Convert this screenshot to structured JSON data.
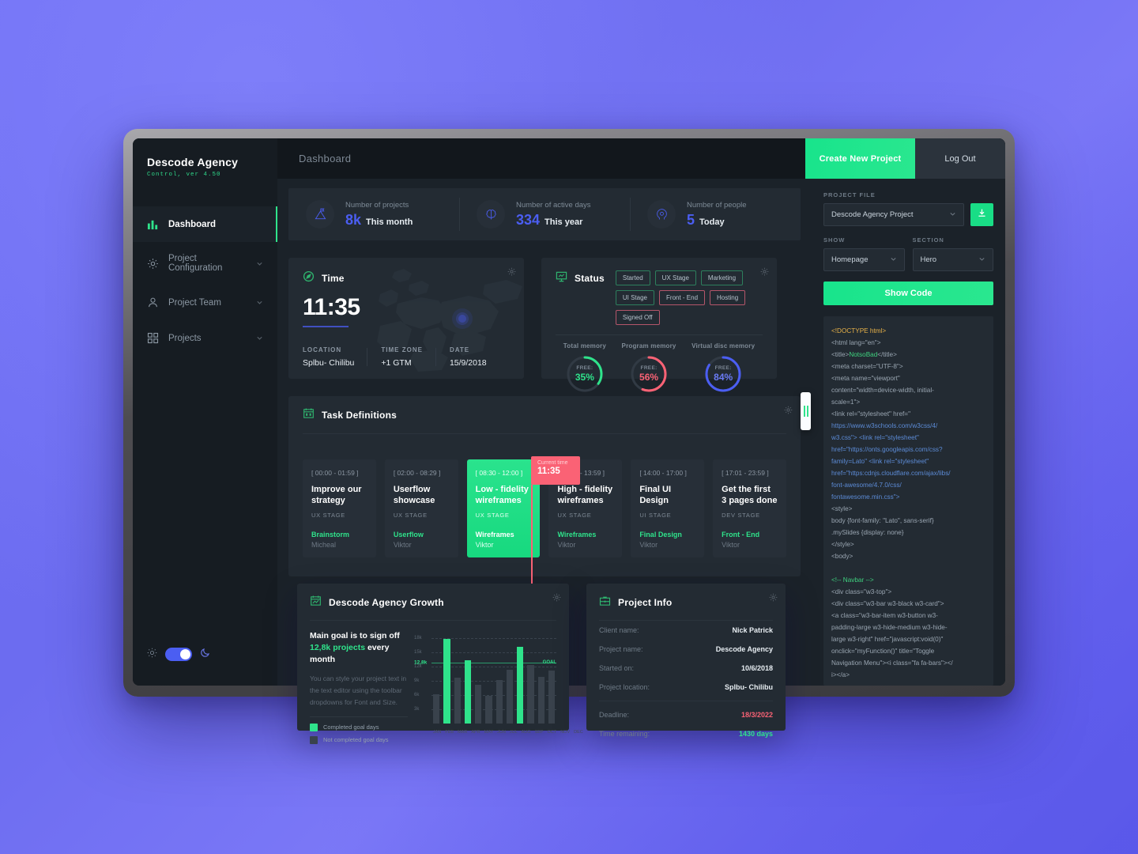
{
  "brand": {
    "title": "Descode Agency",
    "subtitle": "Control, ver 4.50"
  },
  "sidebar": {
    "items": [
      {
        "label": "Dashboard",
        "icon": "chart-bar-icon",
        "active": true,
        "chevron": false
      },
      {
        "label": "Project Configuration",
        "icon": "gear-icon",
        "active": false,
        "chevron": true
      },
      {
        "label": "Project Team",
        "icon": "user-icon",
        "active": false,
        "chevron": true
      },
      {
        "label": "Projects",
        "icon": "grid-icon",
        "active": false,
        "chevron": true
      }
    ],
    "theme_toggle": {
      "light_icon": "sun-icon",
      "dark_icon": "moon-icon",
      "state": "on",
      "accent": "#4b5ef2"
    }
  },
  "topbar": {
    "title": "Dashboard",
    "create_label": "Create New Project",
    "logout_label": "Log Out"
  },
  "stats": [
    {
      "icon": "mountain-flag-icon",
      "label": "Number of projects",
      "value": "8k",
      "period": "This month"
    },
    {
      "icon": "brain-icon",
      "label": "Number of active days",
      "value": "334",
      "period": "This year"
    },
    {
      "icon": "head-gear-icon",
      "label": "Number of people",
      "value": "5",
      "period": "Today"
    }
  ],
  "time_card": {
    "title": "Time",
    "icon": "compass-icon",
    "clock": "11:35",
    "meta": [
      {
        "label": "LOCATION",
        "value": "Splbu- Chilibu"
      },
      {
        "label": "TIME ZONE",
        "value": "+1 GTM"
      },
      {
        "label": "DATE",
        "value": "15/9/2018"
      }
    ]
  },
  "status_card": {
    "title": "Status",
    "icon": "presentation-icon",
    "badges": [
      {
        "label": "Started",
        "tone": "green"
      },
      {
        "label": "UX Stage",
        "tone": "green"
      },
      {
        "label": "Marketing",
        "tone": "green"
      },
      {
        "label": "UI Stage",
        "tone": "green"
      },
      {
        "label": "Front - End",
        "tone": "red"
      },
      {
        "label": "Hosting",
        "tone": "red"
      },
      {
        "label": "Signed Off",
        "tone": "red"
      }
    ],
    "rings": [
      {
        "label": "Total memory",
        "free_label": "FREE:",
        "pct": "35%",
        "value": 35,
        "color": "#2fe38b"
      },
      {
        "label": "Program memory",
        "free_label": "FREE:",
        "pct": "56%",
        "value": 56,
        "color": "#fa6275"
      },
      {
        "label": "Virtual disc memory",
        "free_label": "FREE:",
        "pct": "84%",
        "value": 84,
        "color": "#4b5ef2"
      }
    ]
  },
  "tasks_card": {
    "title": "Task Definitions",
    "icon": "calendar-task-icon",
    "current_time_label": "Current time",
    "current_time": "11:35",
    "tasks": [
      {
        "time": "[ 00:00 - 01:59 ]",
        "name": "Improve our strategy",
        "stage": "UX STAGE",
        "tag": "Brainstorm",
        "user": "Micheal",
        "highlighted": false
      },
      {
        "time": "[ 02:00 - 08:29 ]",
        "name": "Userflow showcase",
        "stage": "UX STAGE",
        "tag": "Userflow",
        "user": "Viktor",
        "highlighted": false
      },
      {
        "time": "[ 08:30 - 12:00 ]",
        "name": "Low - fidelity wireframes",
        "stage": "UX STAGE",
        "tag": "Wireframes",
        "user": "Viktor",
        "highlighted": true
      },
      {
        "time": "[ 12:01 - 13:59 ]",
        "name": "High - fidelity wireframes",
        "stage": "UX STAGE",
        "tag": "Wireframes",
        "user": "Viktor",
        "highlighted": false
      },
      {
        "time": "[ 14:00 - 17:00 ]",
        "name": "Final UI Design",
        "stage": "UI STAGE",
        "tag": "Final Design",
        "user": "Viktor",
        "highlighted": false
      },
      {
        "time": "[ 17:01 - 23:59 ]",
        "name": "Get the first 3 pages done",
        "stage": "DEV STAGE",
        "tag": "Front - End",
        "user": "Viktor",
        "highlighted": false
      }
    ]
  },
  "growth_card": {
    "title": "Descode Agency Growth",
    "icon": "calendar-chart-icon",
    "goal_head_a": "Main goal is to sign off",
    "goal_head_b": "12,8k projects",
    "goal_head_c": " every month",
    "paragraph": "You can style your project text in the text editor using the toolbar dropdowns for Font and Size.",
    "legend": [
      {
        "label": "Completed goal days",
        "color": "#2fe38b"
      },
      {
        "label": "Not completed goal days",
        "color": "#39424c"
      }
    ]
  },
  "chart_data": {
    "type": "bar",
    "title": "Descode Agency Growth",
    "categories": [
      "JAN",
      "FEB",
      "MAR",
      "APR",
      "MAY",
      "JUN",
      "JUL",
      "AUG",
      "SEP",
      "OCT",
      "NOV",
      "DEC"
    ],
    "values": [
      6.2,
      17.8,
      9.6,
      13.4,
      8.2,
      5.9,
      9.2,
      11.4,
      16.2,
      12.4,
      9.8,
      11.2
    ],
    "completed": [
      false,
      true,
      false,
      true,
      false,
      false,
      false,
      false,
      true,
      false,
      false,
      false
    ],
    "goal": 12.8,
    "goal_label": "12,8k",
    "goal_tag": "GOAL",
    "yticks": [
      "18k",
      "15k",
      "12k",
      "9k",
      "6k",
      "3k"
    ],
    "ytick_values": [
      18,
      15,
      12,
      9,
      6,
      3
    ],
    "ylim": [
      0,
      19
    ],
    "xlabel": "",
    "ylabel": "",
    "grid": true,
    "legend_position": "left",
    "series": [
      {
        "name": "Completed goal days",
        "color": "#2fe38b"
      },
      {
        "name": "Not completed goal days",
        "color": "#39424c"
      }
    ]
  },
  "info_card": {
    "title": "Project Info",
    "icon": "briefcase-icon",
    "rows": [
      {
        "key": "Client name:",
        "value": "Nick Patrick",
        "tone": "default"
      },
      {
        "key": "Project name:",
        "value": "Descode Agency",
        "tone": "default"
      },
      {
        "key": "Started on:",
        "value": "10/6/2018",
        "tone": "default"
      },
      {
        "key": "Project location:",
        "value": "Splbu- Chilibu",
        "tone": "default"
      }
    ],
    "rows2": [
      {
        "key": "Deadline:",
        "value": "18/3/2022",
        "tone": "red"
      },
      {
        "key": "Time remaining:",
        "value": "1430 days",
        "tone": "green"
      }
    ]
  },
  "right_panel": {
    "project_file_label": "PROJECT FILE",
    "project_file_value": "Descode Agency Project",
    "download_icon": "download-icon",
    "show_label": "SHOW",
    "show_value": "Homepage",
    "section_label": "SECTION",
    "section_value": "Hero",
    "show_code_label": "Show Code",
    "code_lines": [
      {
        "text": "<!DOCTYPE html>",
        "style": "tag"
      },
      {
        "text": "<html lang=\"en\">",
        "style": "plain"
      },
      {
        "text": "<title>",
        "style": "plain",
        "mid": "NotsoBad",
        "mid_style": "grn",
        "tail": "</title>"
      },
      {
        "text": "<meta charset=\"UTF-8\">",
        "style": "plain"
      },
      {
        "text": "<meta name=\"viewport\"",
        "style": "plain"
      },
      {
        "text": "content=\"width=device-width, initial-",
        "style": "plain"
      },
      {
        "text": "scale=1\">",
        "style": "plain"
      },
      {
        "text": "<link rel=\"stylesheet\" href=\"",
        "style": "plain"
      },
      {
        "text": "https://www.w3schools.com/w3css/4/",
        "style": "str"
      },
      {
        "text": "w3.css\"> <link rel=\"stylesheet\"",
        "style": "mixed-str"
      },
      {
        "text": "href=\"https://onts.googleapis.com/css?",
        "style": "str"
      },
      {
        "text": "family=Lato\" <link rel=\"stylesheet\"",
        "style": "mixed-str"
      },
      {
        "text": "href=\"https:cdnjs.cloudflare.com/ajax/libs/",
        "style": "str"
      },
      {
        "text": "font-awesome/4.7.0/css/",
        "style": "str"
      },
      {
        "text": "fontawesome.min.css\">",
        "style": "mixed-str"
      },
      {
        "text": "<style>",
        "style": "plain"
      },
      {
        "text": "body {font-family: \"Lato\", sans-serif}",
        "style": "plain"
      },
      {
        "text": ".mySlides {display: none}",
        "style": "plain"
      },
      {
        "text": "</style>",
        "style": "plain"
      },
      {
        "text": "<body>",
        "style": "plain"
      },
      {
        "text": "",
        "style": "plain"
      },
      {
        "text": "<!-- Navbar -->",
        "style": "cmt"
      },
      {
        "text": "<div class=\"w3-top\">",
        "style": "plain"
      },
      {
        "text": " <div class=\"w3-bar w3-black w3-card\">",
        "style": "plain"
      },
      {
        "text": "  <a class=\"w3-bar-item w3-button w3-",
        "style": "plain"
      },
      {
        "text": "padding-large w3-hide-medium w3-hide-",
        "style": "plain"
      },
      {
        "text": "large w3-right\" href=\"javascript:void(0)\"",
        "style": "plain"
      },
      {
        "text": "onclick=\"myFunction()\" title=\"Toggle",
        "style": "plain"
      },
      {
        "text": "Navigation Menu\"><i class=\"fa fa-bars\"></",
        "style": "plain"
      },
      {
        "text": "i></a>",
        "style": "plain"
      }
    ]
  },
  "splitter": {
    "icon": "drag-handle-icon"
  },
  "colors": {
    "accent_green": "#2fe38b",
    "accent_blue": "#4b5ef2",
    "accent_red": "#fa6275",
    "card_bg": "#232b33",
    "panel_bg": "#1b2229",
    "sidebar_bg": "#161c22",
    "topbar_bg": "#12171c"
  }
}
